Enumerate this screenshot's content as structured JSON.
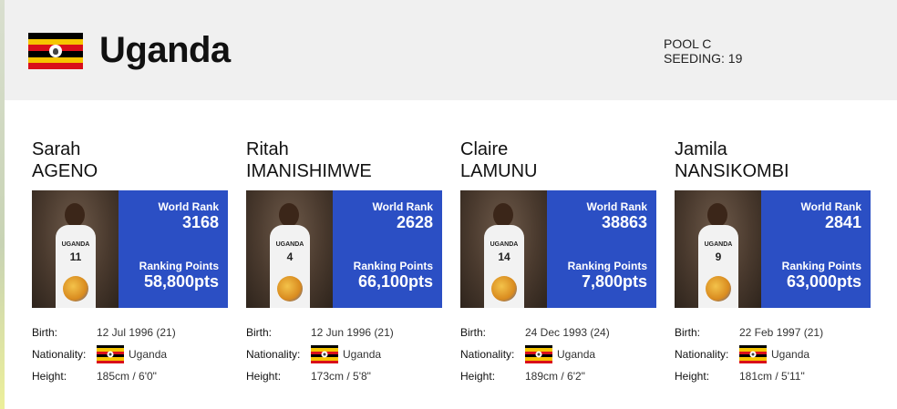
{
  "country": {
    "name": "Uganda",
    "pool": "POOL C",
    "seeding": "SEEDING: 19",
    "flag": {
      "colors": [
        "#000000",
        "#f6c500",
        "#d90f1a"
      ],
      "icon": "uganda-flag-icon"
    }
  },
  "labels": {
    "world_rank": "World Rank",
    "ranking_points": "Ranking Points",
    "birth": "Birth:",
    "nationality": "Nationality:",
    "height": "Height:"
  },
  "accent_color": "#2b4fc4",
  "players": [
    {
      "first": "Sarah",
      "last": "AGENO",
      "rank": "3168",
      "points": "58,800pts",
      "birth": "12 Jul 1996 (21)",
      "nationality": "Uganda",
      "height": "185cm / 6'0\"",
      "jersey": "11",
      "team": "UGANDA"
    },
    {
      "first": "Ritah",
      "last": "IMANISHIMWE",
      "rank": "2628",
      "points": "66,100pts",
      "birth": "12 Jun 1996 (21)",
      "nationality": "Uganda",
      "height": "173cm / 5'8\"",
      "jersey": "4",
      "team": "UGANDA"
    },
    {
      "first": "Claire",
      "last": "LAMUNU",
      "rank": "38863",
      "points": "7,800pts",
      "birth": "24 Dec 1993 (24)",
      "nationality": "Uganda",
      "height": "189cm / 6'2\"",
      "jersey": "14",
      "team": "UGANDA"
    },
    {
      "first": "Jamila",
      "last": "NANSIKOMBI",
      "rank": "2841",
      "points": "63,000pts",
      "birth": "22 Feb 1997 (21)",
      "nationality": "Uganda",
      "height": "181cm / 5'11\"",
      "jersey": "9",
      "team": "UGANDA"
    }
  ]
}
